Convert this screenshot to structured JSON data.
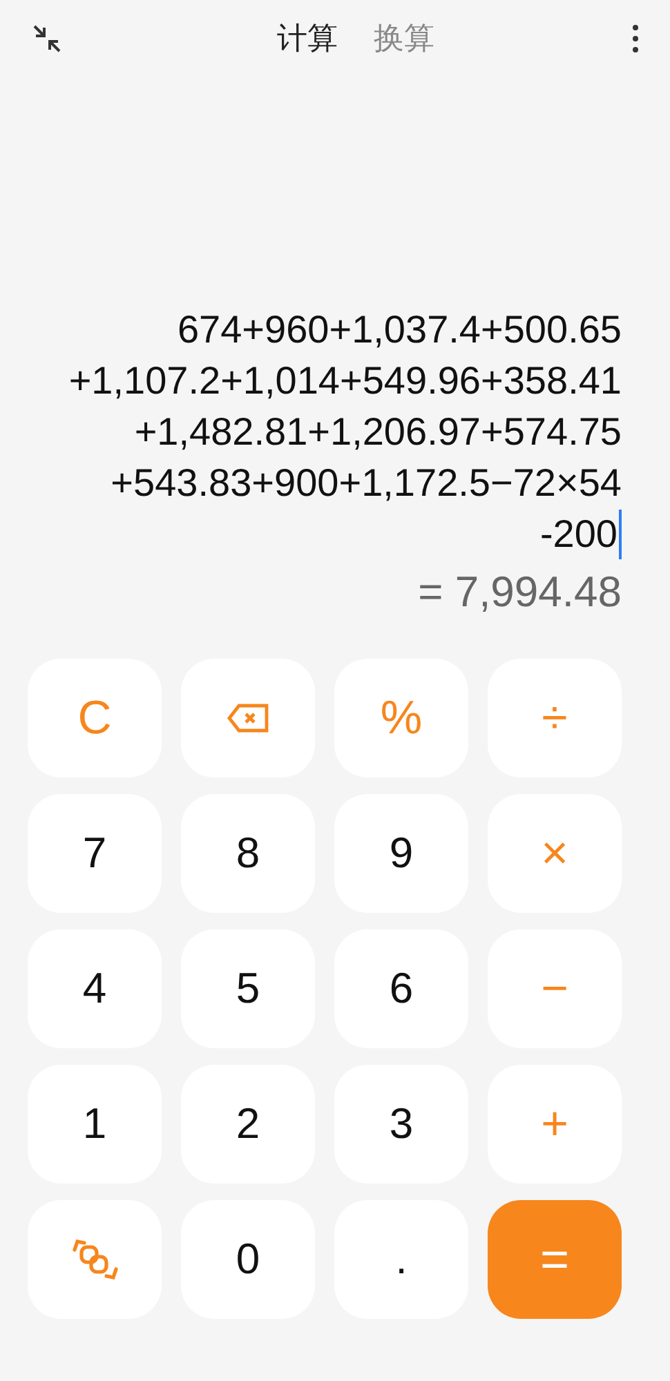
{
  "tabs": [
    {
      "label": "计算",
      "selected": true
    },
    {
      "label": "换算",
      "selected": false
    }
  ],
  "display": {
    "expression_lines": [
      "674+960+1,037.4+500.65",
      "+1,107.2+1,014+549.96+358.41",
      "+1,482.81+1,206.97+574.75",
      "+543.83+900+1,172.5−72×54",
      "-200"
    ],
    "result": "= 7,994.48"
  },
  "keys": [
    {
      "kind": "operator",
      "label": "C"
    },
    {
      "kind": "backspace"
    },
    {
      "kind": "operator",
      "label": "%"
    },
    {
      "kind": "operator",
      "label": "÷"
    },
    {
      "kind": "digit",
      "label": "7"
    },
    {
      "kind": "digit",
      "label": "8"
    },
    {
      "kind": "digit",
      "label": "9"
    },
    {
      "kind": "operator",
      "label": "×"
    },
    {
      "kind": "digit",
      "label": "4"
    },
    {
      "kind": "digit",
      "label": "5"
    },
    {
      "kind": "digit",
      "label": "6"
    },
    {
      "kind": "operator",
      "label": "−"
    },
    {
      "kind": "digit",
      "label": "1"
    },
    {
      "kind": "digit",
      "label": "2"
    },
    {
      "kind": "digit",
      "label": "3"
    },
    {
      "kind": "operator",
      "label": "+"
    },
    {
      "kind": "swap"
    },
    {
      "kind": "digit",
      "label": "0"
    },
    {
      "kind": "digit",
      "label": "."
    },
    {
      "kind": "equals",
      "label": "="
    }
  ]
}
